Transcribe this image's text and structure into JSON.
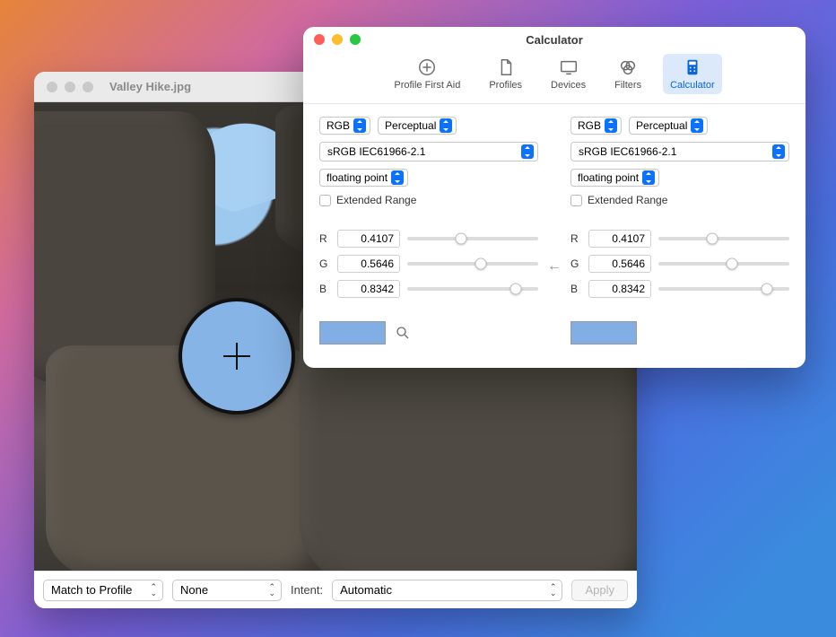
{
  "image_window": {
    "title": "Valley Hike.jpg",
    "toolbar": {
      "action_select": "Match to Profile",
      "profile_select": "None",
      "intent_label": "Intent:",
      "intent_select": "Automatic",
      "apply_label": "Apply"
    }
  },
  "calc_window": {
    "title": "Calculator",
    "tabs": {
      "first_aid": "Profile First Aid",
      "profiles": "Profiles",
      "devices": "Devices",
      "filters": "Filters",
      "calculator": "Calculator"
    },
    "direction_arrow": "←",
    "left": {
      "mode": "RGB",
      "intent": "Perceptual",
      "profile": "sRGB IEC61966-2.1",
      "format": "floating point",
      "extended_label": "Extended Range",
      "channels": {
        "r_label": "R",
        "r_value": "0.4107",
        "g_label": "G",
        "g_value": "0.5646",
        "b_label": "B",
        "b_value": "0.8342"
      },
      "swatch_color": "#82aee6"
    },
    "right": {
      "mode": "RGB",
      "intent": "Perceptual",
      "profile": "sRGB IEC61966-2.1",
      "format": "floating point",
      "extended_label": "Extended Range",
      "channels": {
        "r_label": "R",
        "r_value": "0.4107",
        "g_label": "G",
        "g_value": "0.5646",
        "b_label": "B",
        "b_value": "0.8342"
      },
      "swatch_color": "#82aee6"
    }
  }
}
